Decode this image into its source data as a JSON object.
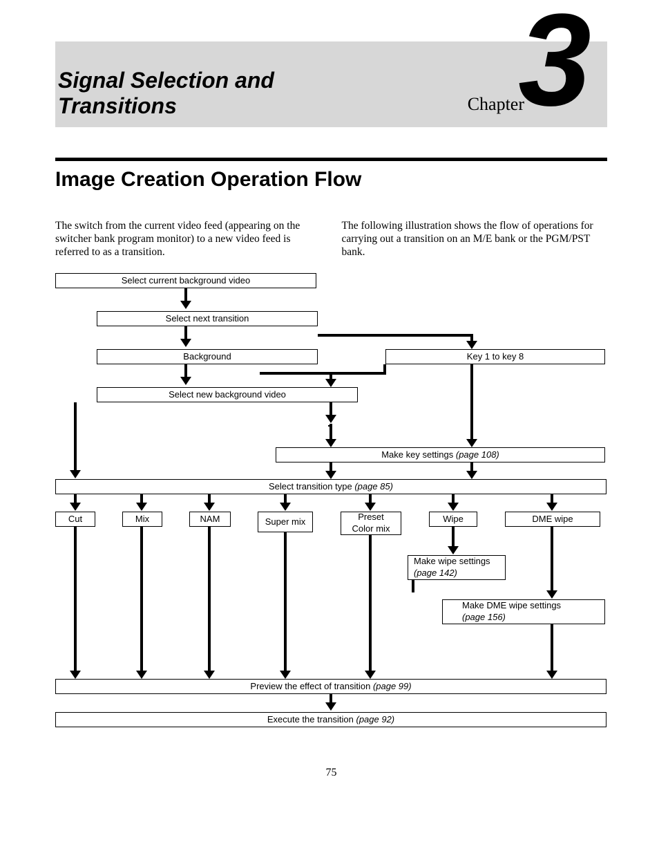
{
  "chapter": {
    "title_line1": "Signal Selection and",
    "title_line2": "Transitions",
    "label": "Chapter",
    "number": "3"
  },
  "section_heading": "Image Creation Operation Flow",
  "para_left": "The switch from the current video feed (appearing on the switcher bank program monitor) to a new video feed is referred to as a transition.",
  "para_right": "The following illustration shows the flow of operations for carrying out a transition on an M/E bank or the PGM/PST bank.",
  "flow": {
    "select_current_bg": "Select current background video",
    "select_next_transition": "Select next transition",
    "background": "Background",
    "key1_8": "Key 1 to key 8",
    "select_new_bg": "Select new background video",
    "make_key_settings": "Make key settings ",
    "make_key_settings_ref": "(page 108)",
    "select_trans_type": "Select transition type ",
    "select_trans_type_ref": "(page 85)",
    "cut": "Cut",
    "mix": "Mix",
    "nam": "NAM",
    "super_mix": "Super mix",
    "preset_color_mix_l1": "Preset",
    "preset_color_mix_l2": "Color mix",
    "wipe": "Wipe",
    "dme_wipe": "DME wipe",
    "make_wipe_settings": "Make wipe settings",
    "make_wipe_settings_ref": "(page 142)",
    "make_dme_wipe_settings": "Make DME wipe settings",
    "make_dme_wipe_settings_ref": "(page 156)",
    "preview": "Preview the effect of transition ",
    "preview_ref": "(page 99)",
    "execute": "Execute the transition ",
    "execute_ref": "(page 92)"
  },
  "page_number": "75"
}
